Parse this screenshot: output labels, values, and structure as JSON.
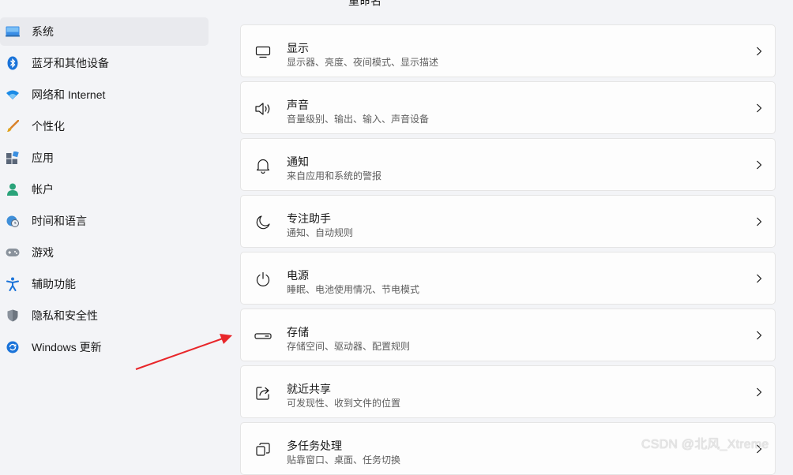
{
  "header": {
    "title": "重命名"
  },
  "sidebar": {
    "items": [
      {
        "label": "系统",
        "icon": "system-icon",
        "active": true
      },
      {
        "label": "蓝牙和其他设备",
        "icon": "bluetooth-icon"
      },
      {
        "label": "网络和 Internet",
        "icon": "wifi-icon"
      },
      {
        "label": "个性化",
        "icon": "brush-icon"
      },
      {
        "label": "应用",
        "icon": "apps-icon"
      },
      {
        "label": "帐户",
        "icon": "account-icon"
      },
      {
        "label": "时间和语言",
        "icon": "globe-clock-icon"
      },
      {
        "label": "游戏",
        "icon": "gamepad-icon"
      },
      {
        "label": "辅助功能",
        "icon": "accessibility-icon"
      },
      {
        "label": "隐私和安全性",
        "icon": "shield-icon"
      },
      {
        "label": "Windows 更新",
        "icon": "update-icon"
      }
    ]
  },
  "main": {
    "cards": [
      {
        "title": "显示",
        "subtitle": "显示器、亮度、夜间模式、显示描述",
        "icon": "display-icon"
      },
      {
        "title": "声音",
        "subtitle": "音量级别、输出、输入、声音设备",
        "icon": "speaker-icon"
      },
      {
        "title": "通知",
        "subtitle": "来自应用和系统的警报",
        "icon": "bell-icon"
      },
      {
        "title": "专注助手",
        "subtitle": "通知、自动规则",
        "icon": "moon-icon"
      },
      {
        "title": "电源",
        "subtitle": "睡眠、电池使用情况、节电模式",
        "icon": "power-icon"
      },
      {
        "title": "存储",
        "subtitle": "存储空间、驱动器、配置规则",
        "icon": "storage-icon"
      },
      {
        "title": "就近共享",
        "subtitle": "可发现性、收到文件的位置",
        "icon": "share-icon"
      },
      {
        "title": "多任务处理",
        "subtitle": "贴靠窗口、桌面、任务切换",
        "icon": "multitask-icon"
      }
    ]
  },
  "watermark": "CSDN @北风_Xtreme",
  "colors": {
    "accent": "#0067c0",
    "annotation_arrow": "#e8262a"
  }
}
